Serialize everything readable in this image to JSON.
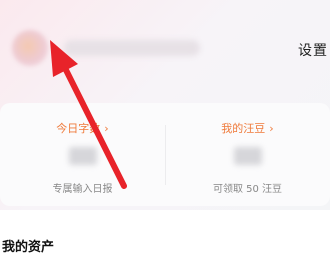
{
  "header": {
    "settings_label": "设置"
  },
  "stats_card": {
    "left": {
      "title": "今日字数",
      "chevron": "›",
      "subtitle": "专属输入日报"
    },
    "right": {
      "title": "我的汪豆",
      "chevron": "›",
      "subtitle": "可领取 50 汪豆"
    }
  },
  "assets_section": {
    "title": "我的资产"
  },
  "colors": {
    "accent_orange": "#ef7a3a",
    "annotation_red": "#e8232a"
  },
  "icons": [
    "avatar",
    "chevron-right-icon",
    "annotation-arrow-icon"
  ]
}
